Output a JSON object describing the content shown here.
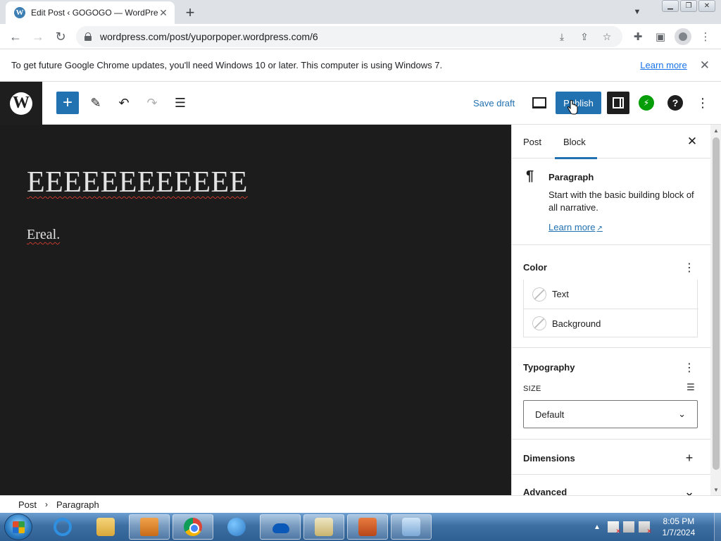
{
  "browser": {
    "tab_title": "Edit Post ‹ GOGOGO — WordPre",
    "url": "wordpress.com/post/yuporpoper.wordpress.com/6",
    "infobar_message": "To get future Google Chrome updates, you'll need Windows 10 or later. This computer is using Windows 7.",
    "infobar_link": "Learn more"
  },
  "editor": {
    "save_draft": "Save draft",
    "publish": "Publish",
    "title": "EEEEEEEEEEEE",
    "paragraph": "Ereal."
  },
  "sidebar": {
    "tabs": [
      "Post",
      "Block"
    ],
    "active_tab": "Block",
    "block_name": "Paragraph",
    "block_description": "Start with the basic building block of all narrative.",
    "block_learn_more": "Learn more",
    "color_panel": {
      "title": "Color",
      "items": [
        "Text",
        "Background"
      ]
    },
    "typography_panel": {
      "title": "Typography",
      "size_label": "SIZE",
      "size_value": "Default"
    },
    "dimensions_title": "Dimensions",
    "advanced_title": "Advanced"
  },
  "breadcrumb": [
    "Post",
    "Paragraph"
  ],
  "taskbar": {
    "time": "8:05 PM",
    "date": "1/7/2024"
  },
  "colors": {
    "wp_blue": "#2271b1",
    "canvas_bg": "#1c1c1d",
    "chrome_tabstrip": "#dee1e6"
  }
}
